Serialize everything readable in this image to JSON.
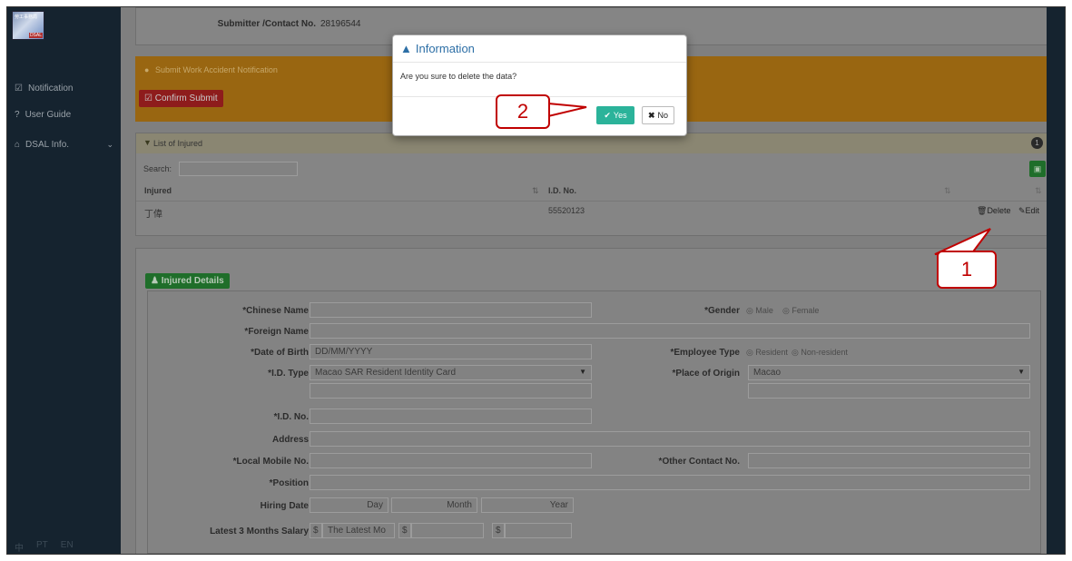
{
  "sidebar": {
    "logo_text": "勞工事務局",
    "logo_badge": "DSAL",
    "items": [
      {
        "icon": "edit-icon",
        "glyph": "☑",
        "label": "Notification"
      },
      {
        "icon": "question-icon",
        "glyph": "?",
        "label": "User Guide"
      },
      {
        "icon": "home-icon",
        "glyph": "⌂",
        "label": "DSAL Info."
      }
    ],
    "languages": [
      "中",
      "PT",
      "EN"
    ]
  },
  "header": {
    "submitter_label": "Submitter /Contact No.",
    "submitter_value": "28196544"
  },
  "submit_section": {
    "title": "Submit Work Accident Notification",
    "confirm_button": "Confirm Submit"
  },
  "injured_list": {
    "title": "List of Injured",
    "count": "1",
    "search_label": "Search:",
    "search_value": "",
    "columns": [
      "Injured",
      "I.D. No."
    ],
    "rows": [
      {
        "name": "丁偉",
        "id_no": "55520123"
      }
    ],
    "delete_label": "Delete",
    "edit_label": "Edit"
  },
  "details": {
    "title": "Injured Details",
    "chinese_name_label": "*Chinese Name",
    "foreign_name_label": "*Foreign Name",
    "dob_label": "*Date of Birth",
    "dob_placeholder": "DD/MM/YYYY",
    "id_type_label": "*I.D. Type",
    "id_type_value": "Macao SAR Resident Identity Card",
    "id_no_label": "*I.D. No.",
    "address_label": "Address",
    "mobile_label": "*Local Mobile No.",
    "position_label": "*Position",
    "hiring_label": "Hiring Date",
    "day_label": "Day",
    "month_label": "Month",
    "year_label": "Year",
    "salary_label": "Latest 3 Months Salary",
    "currency": "$",
    "salary_placeholder": "The Latest Mo",
    "gender_label": "*Gender",
    "gender_options": [
      "Male",
      "Female"
    ],
    "employee_type_label": "*Employee Type",
    "employee_type_options": [
      "Resident",
      "Non-resident"
    ],
    "origin_label": "*Place of Origin",
    "origin_value": "Macao",
    "other_contact_label": "*Other Contact No."
  },
  "modal": {
    "title": "Information",
    "message": "Are you sure to delete the data?",
    "yes_label": "Yes",
    "no_label": "No"
  },
  "callouts": {
    "first": "1",
    "second": "2"
  },
  "colors": {
    "sidebar": "#15232f",
    "overlay": "#7f7f7f",
    "yes": "#2bb39a",
    "callout": "#c00000",
    "modal_title": "#2d6fa6"
  }
}
